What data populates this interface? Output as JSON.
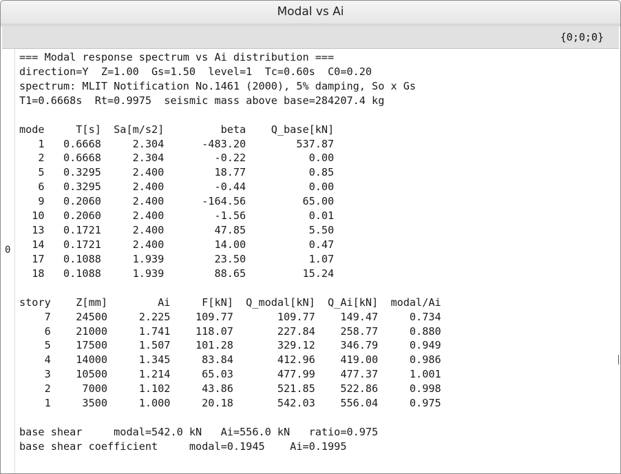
{
  "window": {
    "title": "Modal vs Ai"
  },
  "topbar": {
    "coord": "{0;0;0}"
  },
  "gutter": {
    "line": "0"
  },
  "console": {
    "lines": [
      "=== Modal response spectrum vs Ai distribution ===",
      "direction=Y  Z=1.00  Gs=1.50  level=1  Tc=0.60s  C0=0.20",
      "spectrum: MLIT Notification No.1461 (2000), 5% damping, So x Gs",
      "T1=0.6668s  Rt=0.9975  seismic mass above base=284207.4 kg",
      "",
      "mode     T[s]  Sa[m/s2]         beta    Q_base[kN]",
      "   1   0.6668     2.304      -483.20        537.87",
      "   2   0.6668     2.304        -0.22          0.00",
      "   5   0.3295     2.400        18.77          0.85",
      "   6   0.3295     2.400        -0.44          0.00",
      "   9   0.2060     2.400      -164.56         65.00",
      "  10   0.2060     2.400        -1.56          0.01",
      "  13   0.1721     2.400        47.85          5.50",
      "  14   0.1721     2.400        14.00          0.47",
      "  17   0.1088     1.939        23.50          1.07",
      "  18   0.1088     1.939        88.65         15.24",
      "",
      "story    Z[mm]        Ai     F[kN]  Q_modal[kN]  Q_Ai[kN]  modal/Ai",
      "    7    24500     2.225    109.77       109.77    149.47     0.734",
      "    6    21000     1.741    118.07       227.84    258.77     0.880",
      "    5    17500     1.507    101.28       329.12    346.79     0.949",
      "    4    14000     1.345     83.84       412.96    419.00     0.986",
      "    3    10500     1.214     65.03       477.99    477.37     1.001",
      "    2     7000     1.102     43.86       521.85    522.86     0.998",
      "    1     3500     1.000     20.18       542.03    556.04     0.975",
      "",
      "base shear     modal=542.0 kN   Ai=556.0 kN   ratio=0.975",
      "base shear coefficient     modal=0.1945    Ai=0.1995"
    ]
  }
}
